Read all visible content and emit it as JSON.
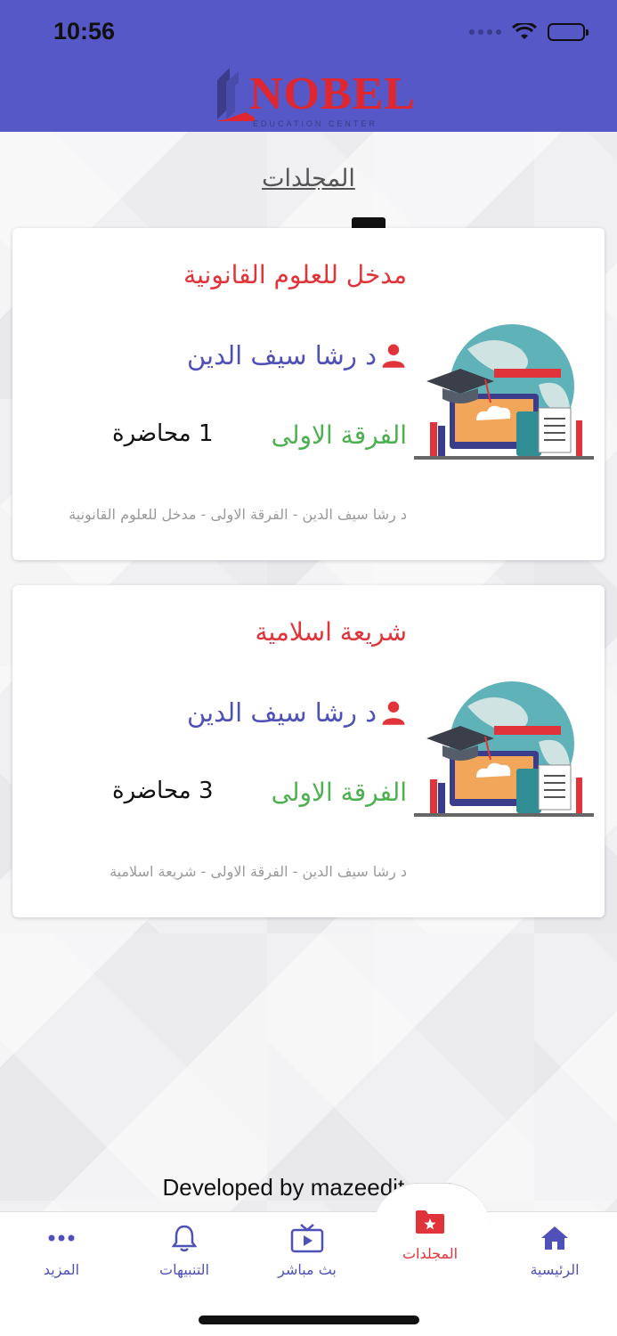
{
  "status_bar": {
    "time": "10:56"
  },
  "logo": {
    "name": "NOBEL",
    "tagline": "EDUCATION CENTER"
  },
  "page_title": "المجلدات",
  "folders": [
    {
      "title": "مدخل للعلوم القانونية",
      "instructor": "د رشا سيف الدين",
      "level": "الفرقة الاولى",
      "lectures": "1 محاضرة",
      "summary": "د رشا سيف الدين - الفرقة الاولى - مدخل للعلوم القانونية"
    },
    {
      "title": "شريعة اسلامية",
      "instructor": "د رشا سيف الدين",
      "level": "الفرقة الاولى",
      "lectures": "3 محاضرة",
      "summary": "د رشا سيف الدين - الفرقة الاولى - شريعة اسلامية"
    }
  ],
  "footer": {
    "developed_by": "Developed by mazeedit.com"
  },
  "tabbar": {
    "more": "المزيد",
    "notifications": "التنبيهات",
    "live": "بث مباشر",
    "folders": "المجلدات",
    "home": "الرئيسية"
  },
  "colors": {
    "header": "#5558c6",
    "accent_red": "#e0343a",
    "accent_blue": "#4f51b8",
    "green": "#4caf50"
  }
}
